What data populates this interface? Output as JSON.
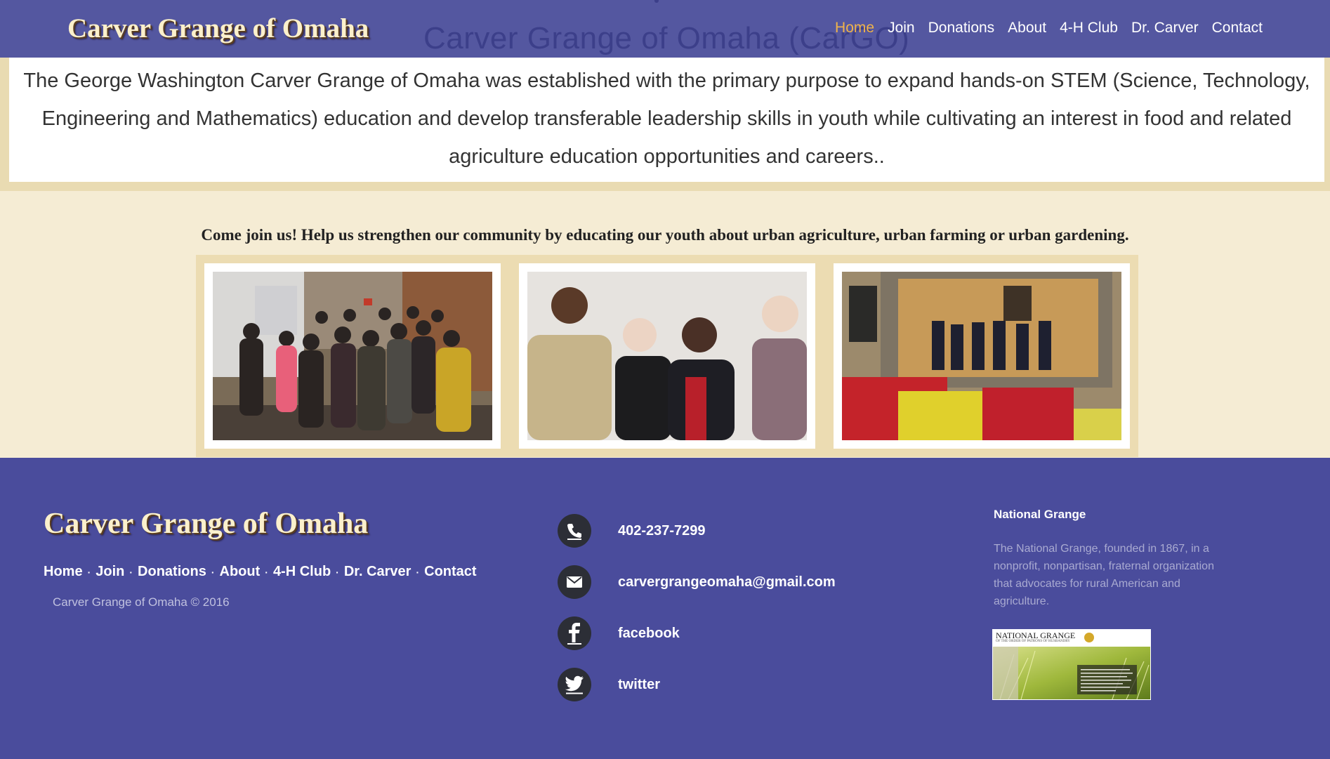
{
  "header": {
    "logo": "Carver Grange of Omaha",
    "page_title": "Carver Grange of Omaha (CarGO)",
    "nav": [
      "Home",
      "Join",
      "Donations",
      "About",
      "4-H Club",
      "Dr. Carver",
      "Contact"
    ],
    "active_nav": "Home"
  },
  "intro": {
    "text": "The George Washington Carver Grange of Omaha was established with the primary purpose to expand hands-on STEM (Science, Technology, Engineering and Mathematics) education and develop transferable leadership skills in youth while cultivating an interest in food and related agriculture education opportunities and careers.."
  },
  "join": {
    "text": "Come join us! Help us strengthen our community by educating our youth about urban agriculture, urban farming or urban gardening."
  },
  "footer": {
    "logo": "Carver Grange of Omaha",
    "links": [
      "Home",
      "Join",
      "Donations",
      "About",
      "4-H Club",
      "Dr. Carver",
      "Contact"
    ],
    "copyright": "Carver Grange of Omaha © 2016",
    "contacts": {
      "phone": "402-237-7299",
      "email": "carvergrangeomaha@gmail.com",
      "facebook": "facebook",
      "twitter": "twitter"
    },
    "national_grange": {
      "title": "National Grange",
      "text": "The National Grange, founded in 1867, in a nonprofit, nonpartisan, fraternal organization that advocates for rural American and agriculture.",
      "image_heading": "NATIONAL GRANGE",
      "image_subheading": "OF THE ORDER OF PATRONS OF HUSBANDRY"
    }
  },
  "colors": {
    "header_bg": "#5457a0",
    "footer_bg": "#4a4c9c",
    "page_bg": "#f5ecd4",
    "active_nav": "#f0b34a",
    "logo_text": "#fbf0cc"
  },
  "icons": [
    "phone-icon",
    "email-icon",
    "facebook-icon",
    "twitter-icon"
  ]
}
